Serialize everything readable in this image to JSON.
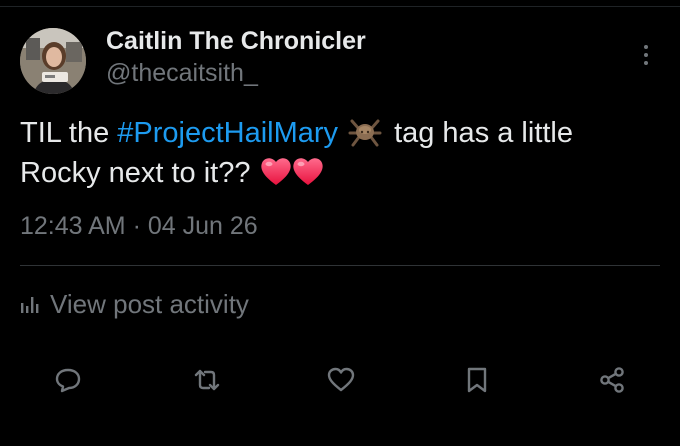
{
  "author": {
    "display_name": "Caitlin The Chronicler",
    "handle": "@thecaitsith_",
    "avatar_icon": "profile-photo"
  },
  "post": {
    "text_before": "TIL the ",
    "hashtag": "#ProjectHailMary",
    "hashtag_emoji_icon": "rocky-spider-emoji",
    "text_after": "tag has a little Rocky next to it?? ",
    "trailing_emojis": [
      "heart-emoji",
      "heart-emoji"
    ],
    "timestamp": "12:43 AM · 04 Jun 26"
  },
  "activity": {
    "icon": "analytics-bars-icon",
    "label": "View post activity"
  },
  "actions": [
    {
      "name": "reply",
      "icon": "speech-bubble-icon"
    },
    {
      "name": "repost",
      "icon": "repost-arrows-icon"
    },
    {
      "name": "like",
      "icon": "heart-outline-icon"
    },
    {
      "name": "bookmark",
      "icon": "bookmark-icon"
    },
    {
      "name": "share",
      "icon": "share-nodes-icon"
    }
  ],
  "colors": {
    "background": "#000000",
    "text_primary": "#e7e9ea",
    "text_secondary": "#71767b",
    "link": "#1d9bf0",
    "heart": "#f8285a",
    "divider": "#2f3336"
  }
}
